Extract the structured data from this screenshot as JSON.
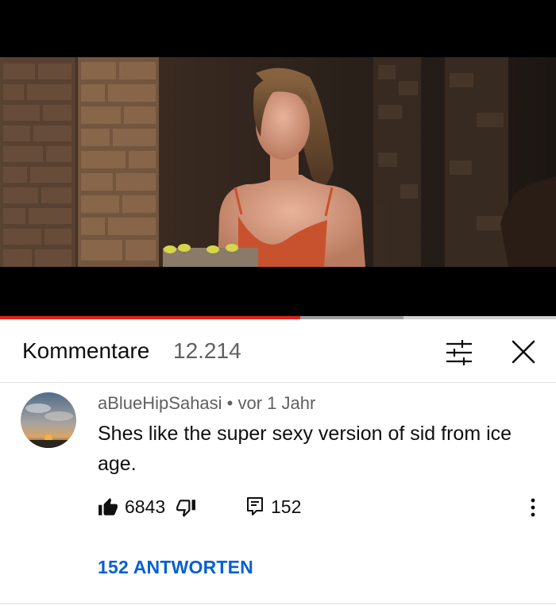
{
  "video": {
    "progress_played": 0.54,
    "progress_buffered_to": 0.725,
    "colors": {
      "played": "#e62117",
      "buffered": "#9e9e9e",
      "track": "#cfcfcf"
    }
  },
  "comments_header": {
    "title": "Kommentare",
    "count": "12.214",
    "filter_icon": "sliders-filter-icon",
    "close_icon": "close-icon"
  },
  "comment": {
    "author": "aBlueHipSahasi",
    "separator": "•",
    "time": "vor 1 Jahr",
    "text": "Shes like the super sexy version of sid from ice age.",
    "likes": "6843",
    "replies_count": "152",
    "replies_link": "152 ANTWORTEN",
    "icons": {
      "like": "thumbs-up-filled-icon",
      "dislike": "thumbs-down-outline-icon",
      "reply": "reply-comment-icon",
      "more": "more-vertical-icon"
    },
    "link_color": "#065fd4"
  }
}
